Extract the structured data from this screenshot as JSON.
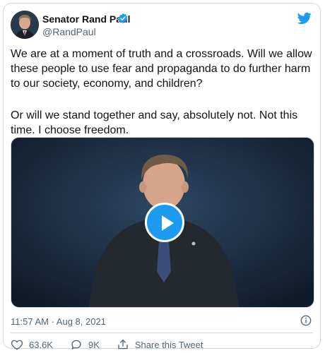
{
  "author": {
    "name": "Senator Rand Paul",
    "handle": "@RandPaul"
  },
  "tweet": {
    "paragraphs": [
      "We are at a moment of truth and a crossroads. Will we allow these people to use fear and propaganda to do further harm to our society, economy, and children?",
      "Or will we stand together and say, absolutely not. Not this time. I choose freedom."
    ],
    "timestamp": "11:57 AM · Aug 8, 2021"
  },
  "actions": {
    "likes": "63.6K",
    "replies": "9K",
    "share": "Share this Tweet"
  },
  "colors": {
    "accent": "#1d9bf0",
    "text": "#0f1419",
    "muted": "#536471",
    "border": "#cfd9de"
  },
  "icons": [
    "avatar",
    "verified-badge-icon",
    "twitter-bird-icon",
    "play-icon",
    "info-icon",
    "heart-icon",
    "reply-icon",
    "share-icon"
  ]
}
